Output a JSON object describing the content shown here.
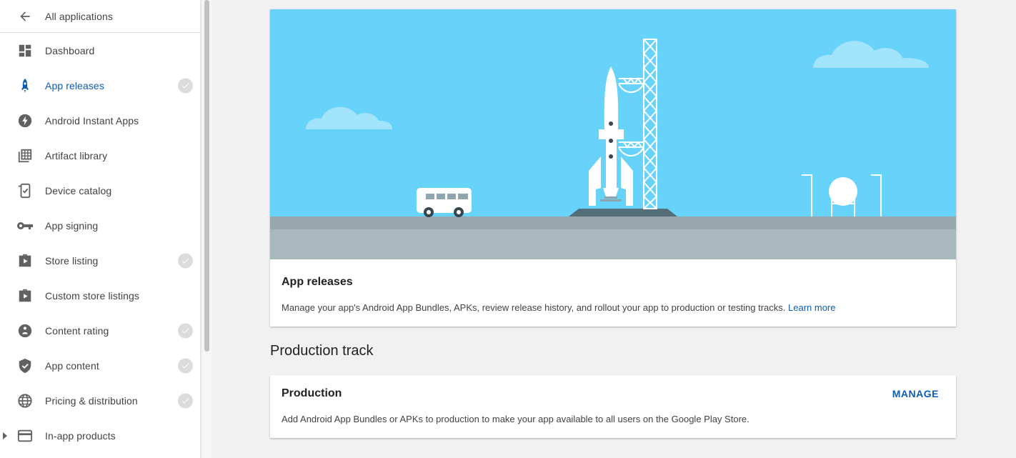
{
  "sidebar": {
    "back_label": "All applications",
    "items": [
      {
        "label": "Dashboard",
        "icon": "dashboard-icon",
        "checked": false,
        "active": false
      },
      {
        "label": "App releases",
        "icon": "rocket-icon",
        "checked": true,
        "active": true
      },
      {
        "label": "Android Instant Apps",
        "icon": "bolt-icon",
        "checked": false,
        "active": false
      },
      {
        "label": "Artifact library",
        "icon": "library-icon",
        "checked": false,
        "active": false
      },
      {
        "label": "Device catalog",
        "icon": "device-icon",
        "checked": false,
        "active": false
      },
      {
        "label": "App signing",
        "icon": "key-icon",
        "checked": false,
        "active": false
      },
      {
        "label": "Store listing",
        "icon": "store-icon",
        "checked": true,
        "active": false
      },
      {
        "label": "Custom store listings",
        "icon": "store-icon",
        "checked": false,
        "active": false
      },
      {
        "label": "Content rating",
        "icon": "rating-icon",
        "checked": true,
        "active": false
      },
      {
        "label": "App content",
        "icon": "shield-icon",
        "checked": true,
        "active": false
      },
      {
        "label": "Pricing & distribution",
        "icon": "globe-icon",
        "checked": true,
        "active": false
      },
      {
        "label": "In-app products",
        "icon": "card-icon",
        "checked": false,
        "active": false
      }
    ]
  },
  "hero_card": {
    "title": "App releases",
    "description": "Manage your app's Android App Bundles, APKs, review release history, and rollout your app to production or testing tracks.",
    "link": "Learn more"
  },
  "section_title": "Production track",
  "production_card": {
    "title": "Production",
    "description": "Add Android App Bundles or APKs to production to make your app available to all users on the Google Play Store.",
    "action": "MANAGE"
  },
  "colors": {
    "accent": "#0d5db0",
    "sky": "#67d3fb",
    "ground": "#a9b8bf",
    "check": "#dcdcdc"
  }
}
